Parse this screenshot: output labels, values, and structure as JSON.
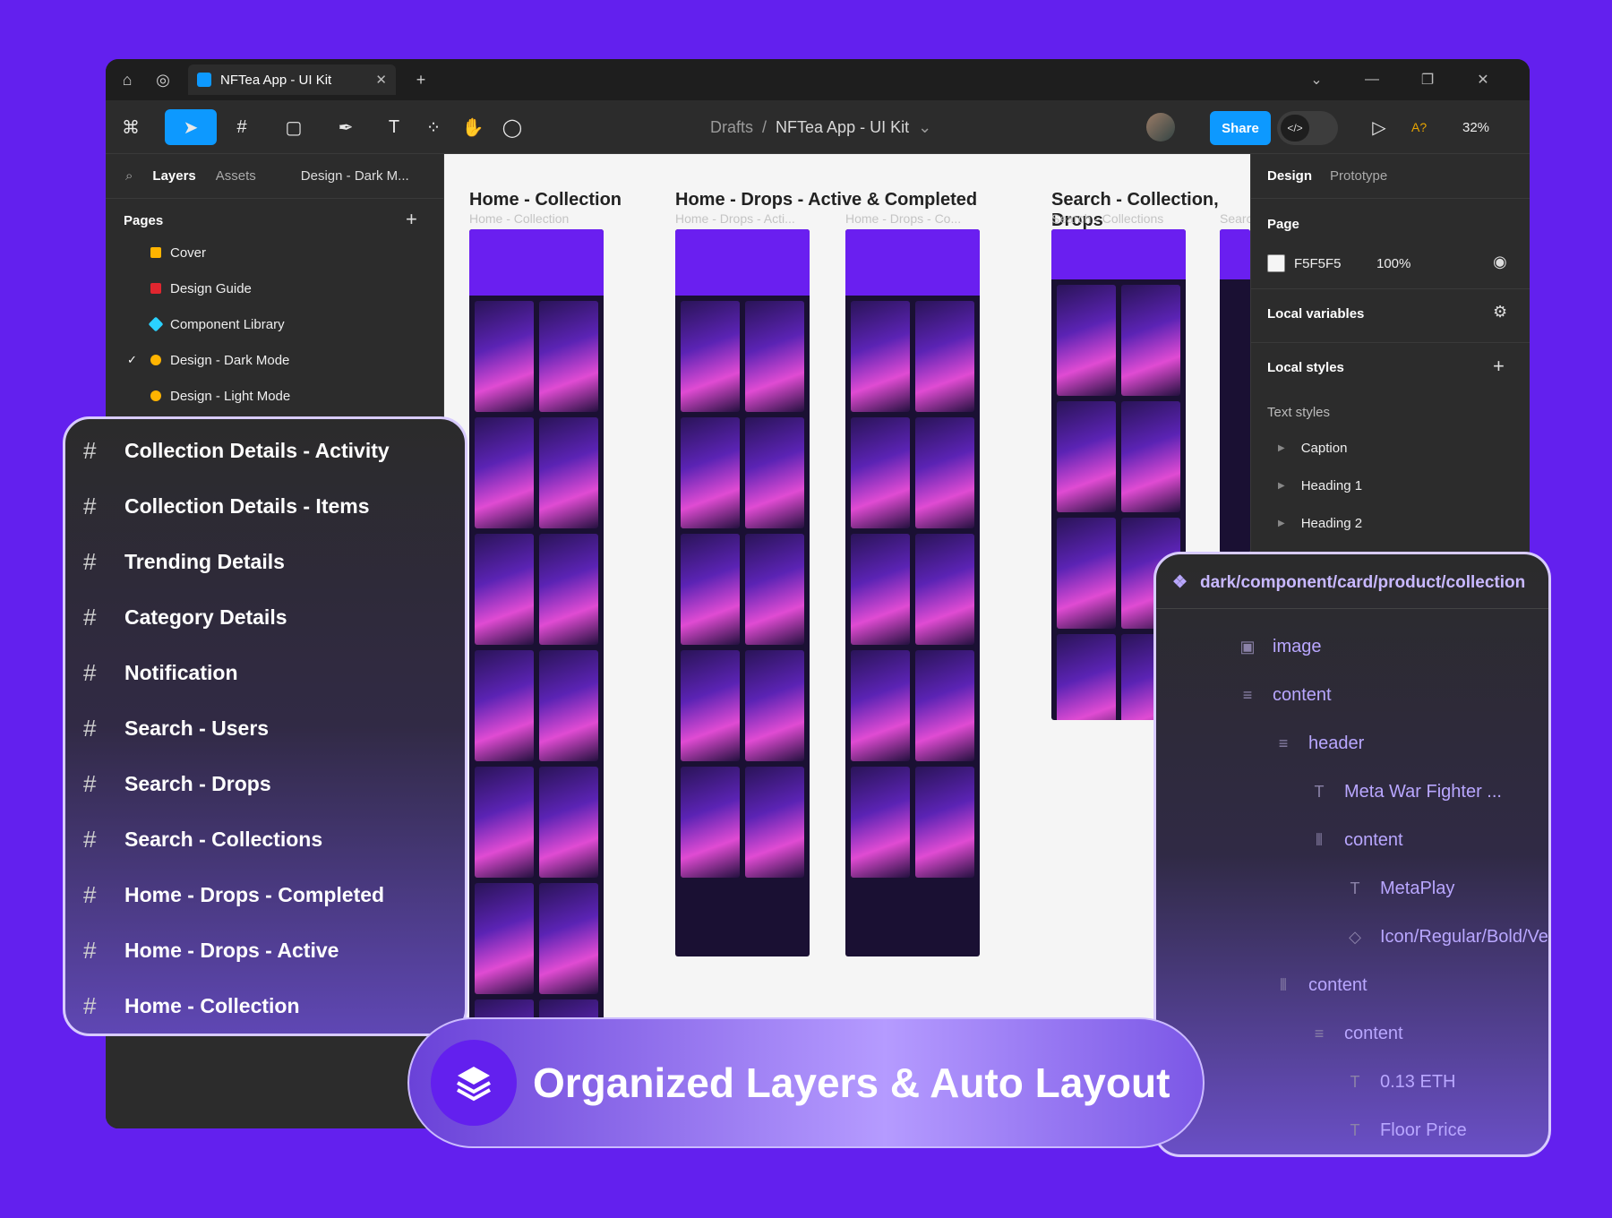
{
  "tab": {
    "title": "NFTea App - UI Kit"
  },
  "toolbar": {
    "breadcrumb_parent": "Drafts",
    "breadcrumb_sep": "/",
    "file_name": "NFTea App - UI Kit",
    "share_label": "Share",
    "font_badge": "A?",
    "zoom": "32%"
  },
  "left_panel": {
    "tab_layers": "Layers",
    "tab_assets": "Assets",
    "current_page": "Design - Dark M...",
    "pages_header": "Pages",
    "pages": [
      {
        "label": "Cover",
        "color": "#ffb400"
      },
      {
        "label": "Design Guide",
        "color": "#e0262f"
      },
      {
        "label": "Component Library",
        "color": "#2ad1ff"
      },
      {
        "label": "Design - Dark Mode",
        "color": "#ffb400",
        "active": true
      },
      {
        "label": "Design - Light Mode",
        "color": "#ffb400"
      }
    ]
  },
  "canvas": {
    "frames": [
      {
        "title": "Home - Collection",
        "sub": "Home - Collection"
      },
      {
        "title": "Home - Drops - Active & Completed",
        "sub": "Home - Drops - Acti..."
      },
      {
        "title": "",
        "sub": "Home - Drops - Co..."
      },
      {
        "title": "Search - Collection, Drops",
        "sub": "Search - Collections"
      },
      {
        "title": "",
        "sub": "Searc"
      }
    ]
  },
  "right_panel": {
    "tab_design": "Design",
    "tab_prototype": "Prototype",
    "page_label": "Page",
    "page_color": "F5F5F5",
    "page_opacity": "100%",
    "local_variables": "Local variables",
    "local_styles": "Local styles",
    "text_styles": "Text styles",
    "styles": [
      "Caption",
      "Heading 1",
      "Heading 2"
    ]
  },
  "layer_list": [
    "Collection Details - Activity",
    "Collection Details - Items",
    "Trending Details",
    "Category Details",
    "Notification",
    "Search - Users",
    "Search - Drops",
    "Search - Collections",
    "Home - Drops - Completed",
    "Home - Drops - Active",
    "Home - Collection"
  ],
  "component_tree": {
    "path": "dark/component/card/product/collection",
    "nodes": [
      {
        "label": "image",
        "icon": "image-icon"
      },
      {
        "label": "content",
        "icon": "auto-layout-vertical-icon"
      },
      {
        "label": "header",
        "icon": "auto-layout-vertical-icon"
      },
      {
        "label": "Meta War Fighter ...",
        "icon": "text-icon"
      },
      {
        "label": "content",
        "icon": "auto-layout-horizontal-icon"
      },
      {
        "label": "MetaPlay",
        "icon": "text-icon"
      },
      {
        "label": "Icon/Regular/Bold/Ve",
        "icon": "instance-icon"
      },
      {
        "label": "content",
        "icon": "auto-layout-horizontal-icon"
      },
      {
        "label": "content",
        "icon": "auto-layout-vertical-icon"
      },
      {
        "label": "0.13 ETH",
        "icon": "text-icon"
      },
      {
        "label": "Floor Price",
        "icon": "text-icon"
      }
    ]
  },
  "banner": {
    "text": "Organized Layers & Auto Layout"
  }
}
